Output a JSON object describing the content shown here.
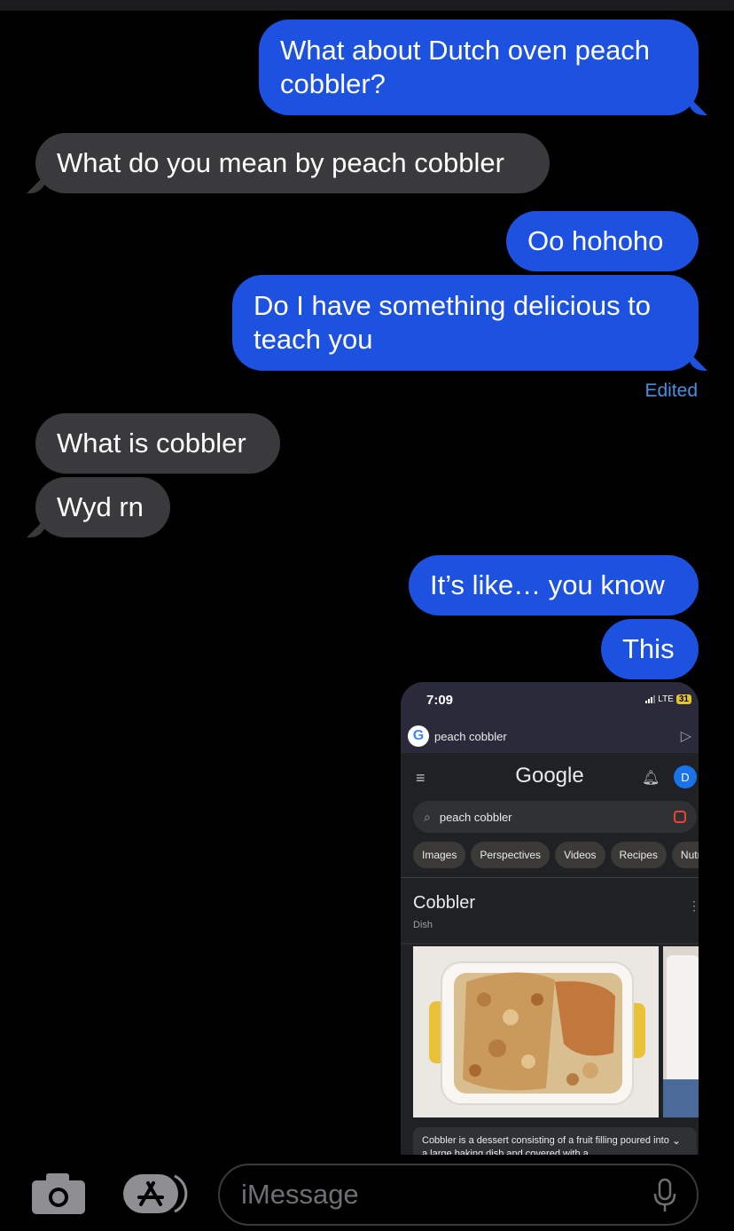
{
  "colors": {
    "outgoing": "#1d52e0",
    "incoming": "#3a3a3c",
    "edited": "#4a90e2",
    "background": "#000000"
  },
  "messages": [
    {
      "direction": "outgoing",
      "text": "What about Dutch oven peach cobbler?"
    },
    {
      "direction": "incoming",
      "text": "What do you mean by peach cobbler"
    },
    {
      "direction": "outgoing",
      "text": "Oo hohoho"
    },
    {
      "direction": "outgoing",
      "text": "Do I have something delicious to teach you"
    },
    {
      "direction": "incoming",
      "text": "What is cobbler"
    },
    {
      "direction": "incoming",
      "text": "Wyd rn"
    },
    {
      "direction": "outgoing",
      "text": "It’s like… you know"
    },
    {
      "direction": "outgoing",
      "text": "This"
    }
  ],
  "edited_label": "Edited",
  "attachment": {
    "status_time": "7:09",
    "network": "LTE",
    "battery": "31",
    "top_query": "peach cobbler",
    "google_logo": "Google",
    "avatar_letter": "D",
    "search_query": "peach cobbler",
    "chips": [
      "Images",
      "Perspectives",
      "Videos",
      "Recipes",
      "Nutr"
    ],
    "kp_title": "Cobbler",
    "kp_subtitle": "Dish",
    "description": "Cobbler is a dessert consisting of a fruit filling poured into a large baking dish and covered with a"
  },
  "input": {
    "placeholder": "iMessage"
  },
  "icons": {
    "camera": "camera-icon",
    "apps": "app-store-icon",
    "mic": "microphone-icon"
  }
}
